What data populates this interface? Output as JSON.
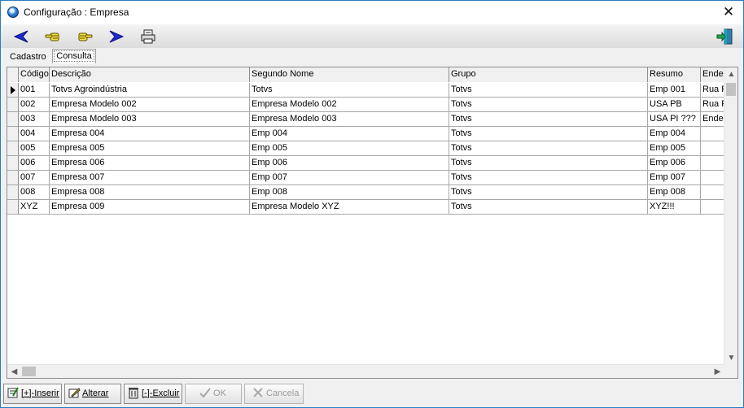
{
  "window": {
    "title": "Configuração : Empresa",
    "close_glyph": "✕"
  },
  "toolbar": {
    "buttons": [
      {
        "name": "previous-record",
        "icon": "blue-arrow-left-icon"
      },
      {
        "name": "first-record",
        "icon": "pointing-hand-left-icon"
      },
      {
        "name": "last-record",
        "icon": "pointing-hand-right-icon"
      },
      {
        "name": "next-record",
        "icon": "blue-arrow-right-icon"
      },
      {
        "name": "print",
        "icon": "printer-icon"
      },
      {
        "name": "exit",
        "icon": "exit-door-icon"
      }
    ]
  },
  "tabs": [
    {
      "label": "Cadastro"
    },
    {
      "label": "Consulta",
      "active": true
    }
  ],
  "grid": {
    "columns": [
      "Código",
      "Descrição",
      "Segundo Nome",
      "Grupo",
      "Resumo",
      "Ende"
    ],
    "rows": [
      [
        "001",
        "Totvs Agroindústria",
        "Totvs",
        "Totvs",
        "Emp 001",
        "Rua F"
      ],
      [
        "002",
        "Empresa Modelo 002",
        "Empresa Modelo 002",
        "Totvs",
        "USA PB",
        "Rua F"
      ],
      [
        "003",
        "Empresa Modelo 003",
        "Empresa Modelo 003",
        "Totvs",
        "USA PI ???",
        "Ender"
      ],
      [
        "004",
        "Empresa 004",
        "Emp 004",
        "Totvs",
        "Emp 004",
        ""
      ],
      [
        "005",
        "Empresa 005",
        "Emp 005",
        "Totvs",
        "Emp 005",
        ""
      ],
      [
        "006",
        "Empresa 006",
        "Emp 006",
        "Totvs",
        "Emp 006",
        ""
      ],
      [
        "007",
        "Empresa 007",
        "Emp 007",
        "Totvs",
        "Emp 007",
        ""
      ],
      [
        "008",
        "Empresa 008",
        "Emp 008",
        "Totvs",
        "Emp 008",
        ""
      ],
      [
        "XYZ",
        "Empresa 009",
        "Empresa Modelo XYZ",
        "Totvs",
        "XYZ!!!",
        ""
      ]
    ],
    "active_row": 0
  },
  "scroll": {
    "up": "▲",
    "down": "▼",
    "left": "◀",
    "right": "▶"
  },
  "actions": {
    "insert": "[+]-Inserir",
    "edit": "Alterar",
    "delete": "[-]-Excluir",
    "ok": "OK",
    "cancel": "Cancela"
  }
}
